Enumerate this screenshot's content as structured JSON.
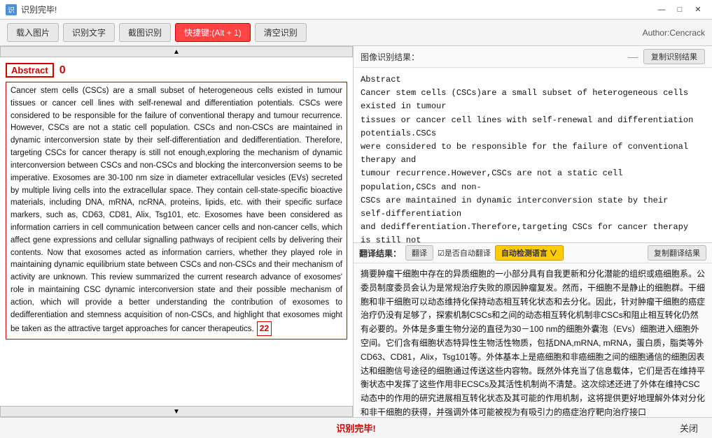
{
  "titleBar": {
    "title": "识别完毕!",
    "iconLabel": "识",
    "controls": {
      "minimize": "—",
      "maximize": "□",
      "close": "✕"
    }
  },
  "toolbar": {
    "loadImage": "载入图片",
    "recognizeText": "识别文字",
    "screenshotRecognize": "截图识别",
    "shortcut": "快捷键:(Alt + 1)",
    "clearRecognize": "清空识别",
    "author": "Author:Cencrack"
  },
  "leftPanel": {
    "abstractLabel": "Abstract",
    "abstractNum": "0",
    "bodyText": "Cancer stem cells (CSCs) are a small subset of heterogeneous cells existed in tumour tissues or cancer cell lines with self-renewal and differentiation potentials. CSCs were considered to be responsible for the failure of conventional therapy and tumour recurrence. However, CSCs are not a static cell population. CSCs and non-CSCs are maintained in dynamic interconversion state by their self-differentiation and dedifferentiation. Therefore, targeting CSCs for cancer therapy is still not enough,exploring the mechanism of dynamic interconversion between CSCs and non-CSCs and blocking the interconversion seems to be imperative. Exosomes are 30-100 nm size in diameter extracellular vesicles (EVs) secreted by multiple living cells into the extracellular space. They contain cell-state-specific bioactive materials, including DNA, mRNA, ncRNA, proteins, lipids, etc. with their specific surface markers, such as, CD63, CD81, Alix, Tsg101, etc. Exosomes have been considered as information carriers in cell communication between cancer cells and non-cancer cells, which affect gene expressions and cellular signalling pathways of recipient cells by delivering their contents. Now that exosomes acted as information carriers, whether they played role in maintaining dynamic equilibrium state between CSCs and non-CSCs and their mechanism of activity are unknown. This review summarized the current research advance of exosomes' role in maintaining CSC dynamic interconversion state and their possible mechanism of action, which will provide a better understanding the contribution of exosomes to dedifferentiation and stemness acquisition of non-CSCs, and highlight that exosomes might be taken as the attractive target approaches for cancer therapeutics.",
    "pageNum": "22"
  },
  "rightPanel": {
    "ocrHeader": {
      "label": "图像识别结果：",
      "dash": "—",
      "copyBtn": "复制识别结果"
    },
    "ocrText": "Abstract\nCancer stem cells (CSCs)are a small subset of heterogeneous cells\nexisted in tumour\ntissues or cancer cell lines with self-renewal and differentiation\npotentials.CSCs\nwere considered to be responsible for the failure of conventional\ntherapy and\ntumour recurrence.However,CSCs are not a static cell\npopulation,CSCs and non-\nCSCs are maintained in dynamic interconversion state by their\nself-differentiation\nand dedifferentiation.Therefore,targeting CSCs for cancer therapy\nis still not\nenough,exploring the mechanism of dynamic interconversion between\nCSCs and\nnon-CSCs and blocking the interconversion seems to be\nimperative.Exosomes are\n30-100 nm size in diameter extracellular vesicles (EVs) secreted by",
    "translationSection": {
      "label": "翻译结果：",
      "translateBtn": "翻译",
      "autoTranslateCheckLabel": "☑是否自动翻译",
      "autoDetectBtn": "自动检测语言 ∨",
      "copyBtn": "复制翻译结果",
      "text": "摘要肿瘤干细胞中存在的异质细胞的一小部分具有自我更新和分化潜能的组织或癌细胞系。公委员制度委员会认为是常规治疗失败的原因肿瘤复发。然而，干细胞不是静止的细胞群。干细胞和非干细胞可以动态维持化保持动态相互转化状态和去分化。因此，针对肿瘤干细胞的癌症治疗仍没有足够了，探索机制CSCs和之间的动态相互转化机制非CSCs和阻止相互转化仍然有必要的。外体是多重生物分泌的直径为30－100 nm的细胞外囊泡（EVs）细胞进入细胞外空间。它们含有细胞状态特异性生物活性物质，包括DNA,mRNA, mRNA，蛋白质，脂类等外CD63、CD81，Alix，Tsg101等。外体基本上是癌细胞和非癌细胞之间的细胞通信的细胞因表达和细胞信号途径的细胞通过传送这些内容物。既然外体充当了信息载体，它们是否在维持平衡状态中发挥了这些作用非ECSCs及其活性机制尚不清楚。这次综述还进了外体在维持CSC动态中的作用的研究进展相互转化状态及其可能的作用机制，这将提供更好地理解外体对分化和非干细胞的获得，并强调外体可能被视为有吸引力的癌症治疗靶向治疗接口"
    }
  },
  "statusBar": {
    "statusText": "识别完毕!",
    "closeLink": "关闭"
  }
}
